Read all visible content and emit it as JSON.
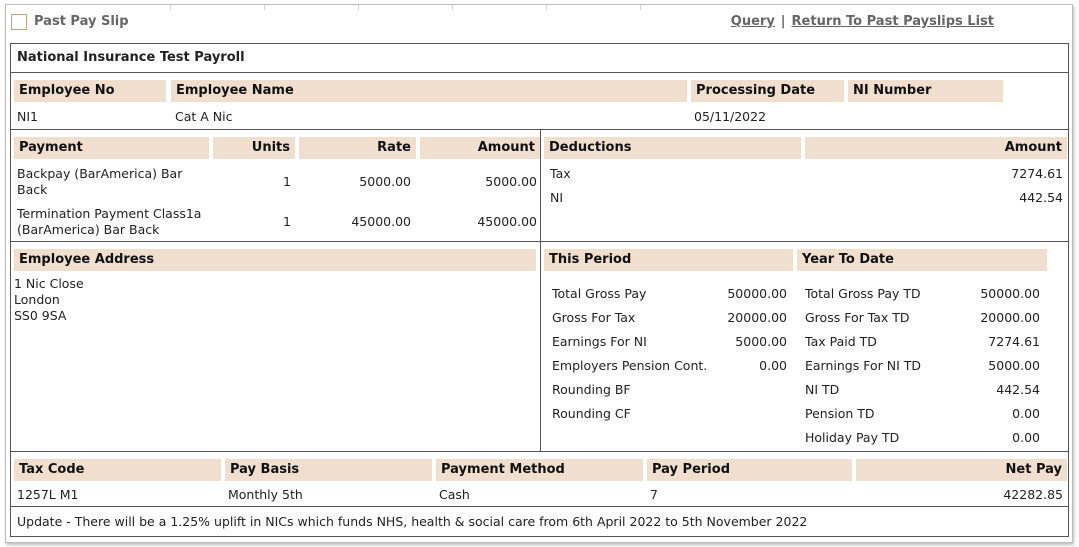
{
  "header": {
    "title": "Past Pay Slip",
    "links": {
      "query": "Query",
      "separator": "|",
      "return": "Return To Past Payslips List"
    }
  },
  "payroll_name": "National Insurance Test Payroll",
  "employee": {
    "headers": {
      "no": "Employee No",
      "name": "Employee Name",
      "date": "Processing Date",
      "ni": "NI Number"
    },
    "values": {
      "no": "NI1",
      "name": "Cat A Nic",
      "date": "05/11/2022",
      "ni": ""
    }
  },
  "payments": {
    "headers": {
      "payment": "Payment",
      "units": "Units",
      "rate": "Rate",
      "amount": "Amount"
    },
    "rows": [
      {
        "line1": "Backpay (BarAmerica) Bar",
        "line2": "Back",
        "units": "1",
        "rate": "5000.00",
        "amount": "5000.00"
      },
      {
        "line1": "Termination Payment Class1a",
        "line2": "(BarAmerica) Bar Back",
        "units": "1",
        "rate": "45000.00",
        "amount": "45000.00"
      }
    ]
  },
  "deductions": {
    "headers": {
      "deductions": "Deductions",
      "amount": "Amount"
    },
    "rows": [
      {
        "name": "Tax",
        "amount": "7274.61"
      },
      {
        "name": "NI",
        "amount": "442.54"
      }
    ]
  },
  "address": {
    "header": "Employee Address",
    "lines": [
      "1 Nic Close",
      "London",
      "SS0 9SA"
    ]
  },
  "this_period": {
    "header": "This Period",
    "rows": [
      {
        "label": "Total Gross Pay",
        "value": "50000.00"
      },
      {
        "label": "Gross For Tax",
        "value": "20000.00"
      },
      {
        "label": "Earnings For NI",
        "value": "5000.00"
      },
      {
        "label": "Employers Pension Cont.",
        "value": "0.00"
      },
      {
        "label": "Rounding BF",
        "value": ""
      },
      {
        "label": "Rounding CF",
        "value": ""
      }
    ]
  },
  "year_to_date": {
    "header": "Year To Date",
    "rows": [
      {
        "label": "Total Gross Pay TD",
        "value": "50000.00"
      },
      {
        "label": "Gross For Tax TD",
        "value": "20000.00"
      },
      {
        "label": "Tax Paid TD",
        "value": "7274.61"
      },
      {
        "label": "Earnings For NI TD",
        "value": "5000.00"
      },
      {
        "label": "NI TD",
        "value": "442.54"
      },
      {
        "label": "Pension TD",
        "value": "0.00"
      },
      {
        "label": "Holiday Pay TD",
        "value": "0.00"
      }
    ]
  },
  "footer": {
    "headers": {
      "tax_code": "Tax Code",
      "pay_basis": "Pay Basis",
      "method": "Payment Method",
      "period": "Pay Period",
      "net": "Net Pay"
    },
    "values": {
      "tax_code": "1257L M1",
      "pay_basis": "Monthly 5th",
      "method": "Cash",
      "period": "7",
      "net": "42282.85"
    }
  },
  "notice": "Update - There will be a 1.25% uplift in NICs which funds NHS, health & social care from 6th April 2022 to 5th November 2022",
  "colors": {
    "header_bg": "#f0dfcf",
    "border": "#555555",
    "link": "#666666"
  }
}
